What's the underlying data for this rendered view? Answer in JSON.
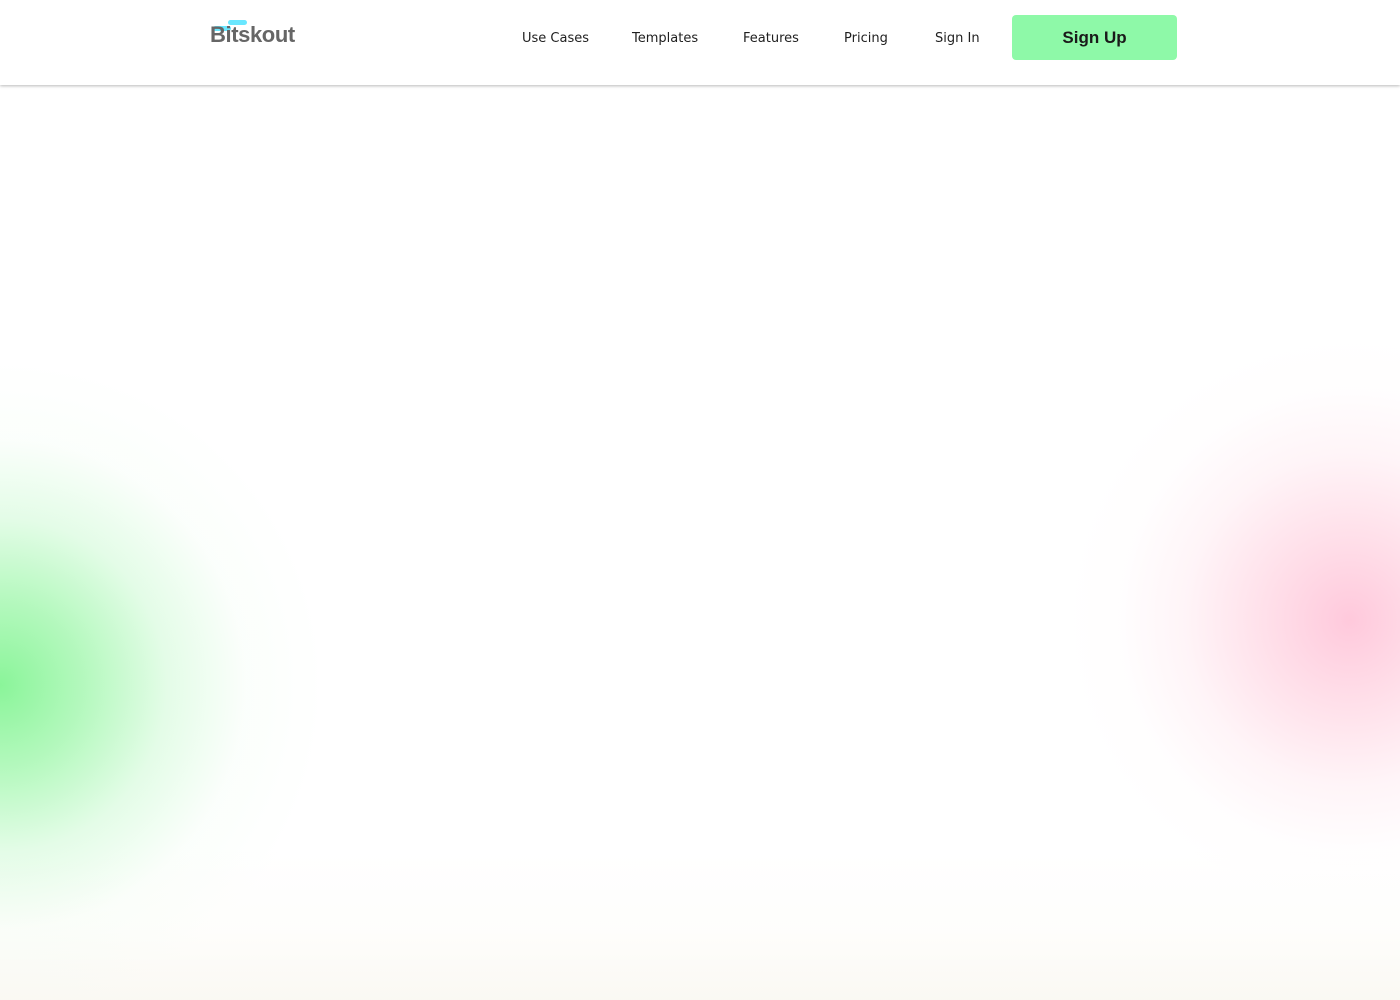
{
  "brand": {
    "name": "Bitskout",
    "logo_accent_color": "#69e7ff",
    "logo_text_color": "#666666"
  },
  "navigation": {
    "items": [
      {
        "label": "Use Cases"
      },
      {
        "label": "Templates"
      },
      {
        "label": "Features"
      },
      {
        "label": "Pricing"
      },
      {
        "label": "Sign In"
      }
    ]
  },
  "actions": {
    "signup_label": "Sign Up",
    "signup_color": "#8ef9a8"
  },
  "background": {
    "base_color": "#ffffff",
    "left_glow_color": "#84f494",
    "right_glow_color": "#ffc6da"
  }
}
